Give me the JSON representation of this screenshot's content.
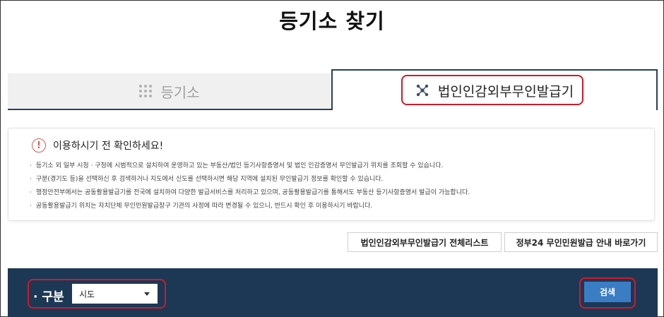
{
  "page_title": "등기소 찾기",
  "tabs": [
    {
      "label": "등기소",
      "icon": "grid-dots-icon",
      "active": false
    },
    {
      "label": "법인인감외부무인발급기",
      "icon": "network-nodes-icon",
      "active": true
    }
  ],
  "notice": {
    "heading": "이용하시기 전 확인하세요!",
    "icon": "exclamation-circle-icon",
    "items": [
      "등기소 외 일부 시청 · 구청에 시범적으로 설치하여 운영하고 있는 부동산/법인 등기사항증명서 및 법인 인감증명서 무인발급기 위치를 조회할 수 있습니다.",
      "구분(경기도 등)을 선택하신 후 검색하거나 지도에서 신도를 선택하시면 해당 지역에 설치된 무인발급기 정보를 확인할 수 있습니다.",
      "행정안전부에서는 공동활용발급기를 전국에 설치하여 다양한 발급서비스를 처리하고 있으며, 공동활용발급기를 통해서도 부동산 등기사항증명서 발급이 가능합니다.",
      "공동활용발급기 위치는 자치단체 무인민원발급창구 기관의 사정에 따라 변경될 수 있으니, 반드시 확인 후 이용하시기 바랍니다."
    ]
  },
  "buttons": {
    "full_list": "법인인감외부무인발급기 전체리스트",
    "gov24": "정부24 무인민원발급 안내 바로가기"
  },
  "search": {
    "filter_label": "· 구분",
    "select_value": "시도",
    "search_button": "검색"
  },
  "colors": {
    "panel_bg": "#1d3855",
    "search_button": "#3a7dc4",
    "highlight": "#d0192a",
    "tab_border": "#2b3f59"
  }
}
